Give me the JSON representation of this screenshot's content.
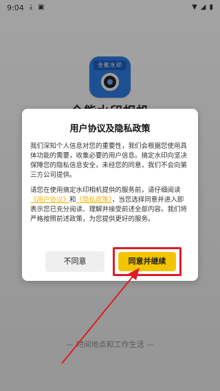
{
  "status_bar": {
    "time": "9:04",
    "icons": [
      "download-icon",
      "notification-icon",
      "wifi-icon",
      "signal-icon",
      "battery-icon"
    ]
  },
  "background": {
    "app_name": "全能水印相机",
    "app_icon_badge_text": "全能水印",
    "tagline": "— 时间地点和工作生活 —"
  },
  "dialog": {
    "title": "用户协议及隐私政策",
    "paragraph1": "我们深知个人信息对您的重要性，我们会根据您使用具体功能的需要，收集必要的用户信息。搞定水印向坚决保障您的隐私信息安全，未经您的同意，我们不会向第三方公司提供。",
    "paragraph2_a": "请您在使用搞定水印相机提供的服务前，请仔细阅读",
    "link_user_agreement": "《用户协议》",
    "paragraph2_and": "和",
    "link_privacy_policy": "《隐私政策》",
    "paragraph2_b": "，当您选择同意并进入即表示您已充分阅读、理解并接受前述全部内容。我们将严格按照前述政策，为您提供更好的服务。",
    "decline_label": "不同意",
    "accept_label": "同意并继续"
  },
  "colors": {
    "accent": "#f4c400",
    "highlight": "#e01b24",
    "link": "#f0b400"
  }
}
